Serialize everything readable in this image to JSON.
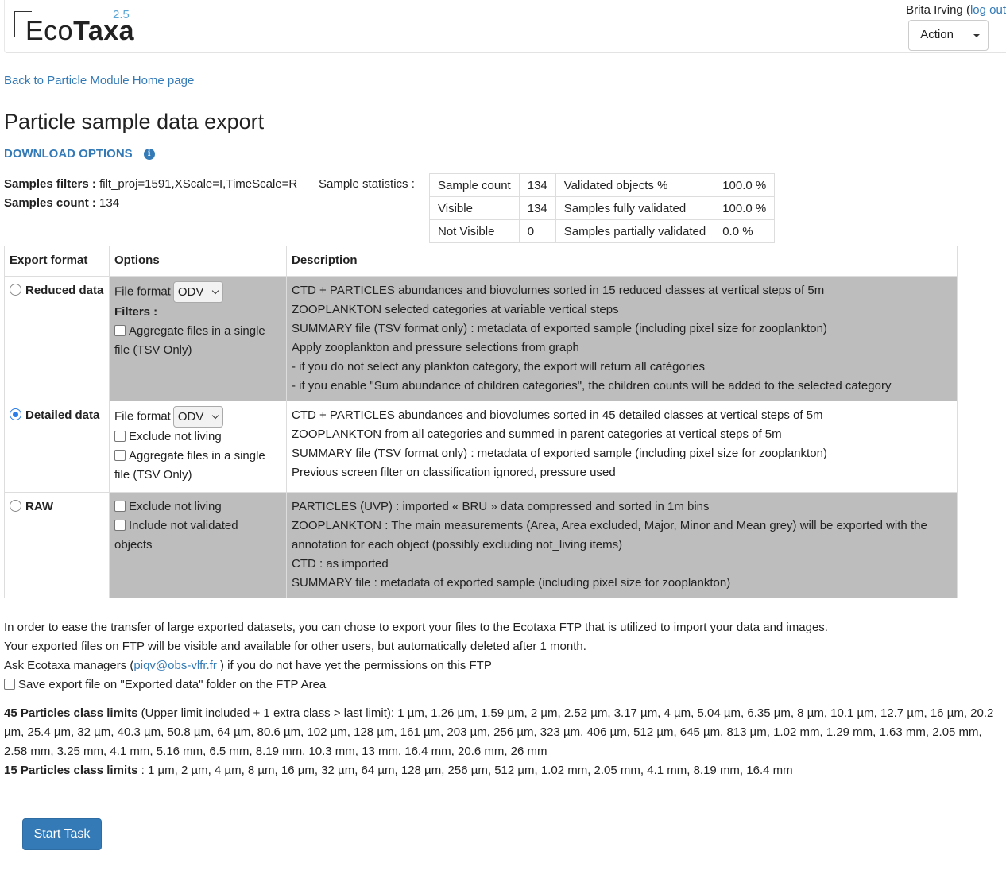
{
  "header": {
    "logo_text_light": "Eco",
    "logo_text_bold": "Taxa",
    "version": "2.5",
    "user_name": "Brita Irving",
    "logout_label": "log out",
    "action_label": "Action"
  },
  "back_link": "Back to Particle Module Home page",
  "page_title": "Particle sample data export",
  "download_options": "DOWNLOAD OPTIONS",
  "filters": {
    "samples_filters_label": "Samples filters :",
    "samples_filters_value": "filt_proj=1591,XScale=I,TimeScale=R",
    "samples_count_label": "Samples count :",
    "samples_count_value": "134"
  },
  "stats": {
    "label": "Sample statistics :",
    "rows": [
      [
        "Sample count",
        "134",
        "Validated objects %",
        "100.0 %"
      ],
      [
        "Visible",
        "134",
        "Samples fully validated",
        "100.0 %"
      ],
      [
        "Not Visible",
        "0",
        "Samples partially validated",
        "0.0 %"
      ]
    ]
  },
  "export_table": {
    "headers": [
      "Export format",
      "Options",
      "Description"
    ],
    "reduced": {
      "label": "Reduced data",
      "selected": false,
      "file_format_label": "File format",
      "file_format_value": "ODV",
      "filters_label": "Filters :",
      "aggregate_line1": "Aggregate files in a single",
      "aggregate_line2": "file (TSV Only)",
      "description": [
        "CTD + PARTICLES abundances and biovolumes sorted in 15 reduced classes at vertical steps of 5m",
        "ZOOPLANKTON selected categories at variable vertical steps",
        "SUMMARY file (TSV format only) : metadata of exported sample (including pixel size for zooplankton)",
        "Apply zooplankton and pressure selections from graph",
        "- if you do not select any plankton category, the export will return all catégories",
        "- if you enable \"Sum abundance of children categories\", the children counts will be added to the selected category"
      ]
    },
    "detailed": {
      "label": "Detailed data",
      "selected": true,
      "file_format_label": "File format",
      "file_format_value": "ODV",
      "exclude_label": "Exclude not living",
      "aggregate_line1": "Aggregate files in a single",
      "aggregate_line2": "file (TSV Only)",
      "description": [
        "CTD + PARTICLES abundances and biovolumes sorted in 45 detailed classes at vertical steps of 5m",
        "ZOOPLANKTON from all categories and summed in parent categories at vertical steps of 5m",
        "SUMMARY file (TSV format only) : metadata of exported sample (including pixel size for zooplankton)",
        "Previous screen filter on classification ignored, pressure used"
      ]
    },
    "raw": {
      "label": "RAW",
      "selected": false,
      "exclude_label": "Exclude not living",
      "include_line1": "Include not validated",
      "include_line2": "objects",
      "description": [
        "PARTICLES (UVP) : imported « BRU » data compressed and sorted in 1m bins",
        "ZOOPLANKTON : The main measurements (Area, Area excluded, Major, Minor and Mean grey) will be exported with the",
        "annotation for each object (possibly excluding not_living items)",
        "CTD : as imported",
        "SUMMARY file : metadata of exported sample (including pixel size for zooplankton)"
      ]
    }
  },
  "ftp": {
    "line1": "In order to ease the transfer of large exported datasets, you can chose to export your files to the Ecotaxa FTP that is utilized to import your data and images.",
    "line2": "Your exported files on FTP will be visible and available for other users, but automatically deleted after 1 month.",
    "line3_pre": "Ask Ecotaxa managers (",
    "line3_email": "piqv@obs-vlfr.fr",
    "line3_post": " ) if you do not have yet the permissions on this FTP",
    "checkbox_label": "Save export file on \"Exported data\" folder on the FTP Area"
  },
  "limits": {
    "l45_label": "45 Particles class limits",
    "l45_text": " (Upper limit included + 1 extra class > last limit): 1 µm, 1.26 µm, 1.59 µm, 2 µm, 2.52 µm, 3.17 µm, 4 µm, 5.04 µm, 6.35 µm, 8 µm, 10.1 µm, 12.7 µm, 16 µm, 20.2 µm, 25.4 µm, 32 µm, 40.3 µm, 50.8 µm, 64 µm, 80.6 µm, 102 µm, 128 µm, 161 µm, 203 µm, 256 µm, 323 µm, 406 µm, 512 µm, 645 µm, 813 µm, 1.02 mm, 1.29 mm, 1.63 mm, 2.05 mm, 2.58 mm, 3.25 mm, 4.1 mm, 5.16 mm, 6.5 mm, 8.19 mm, 10.3 mm, 13 mm, 16.4 mm, 20.6 mm, 26 mm",
    "l15_label": "15 Particles class limits",
    "l15_text": " : 1 µm, 2 µm, 4 µm, 8 µm, 16 µm, 32 µm, 64 µm, 128 µm, 256 µm, 512 µm, 1.02 mm, 2.05 mm, 4.1 mm, 8.19 mm, 16.4 mm"
  },
  "start_button": "Start Task"
}
